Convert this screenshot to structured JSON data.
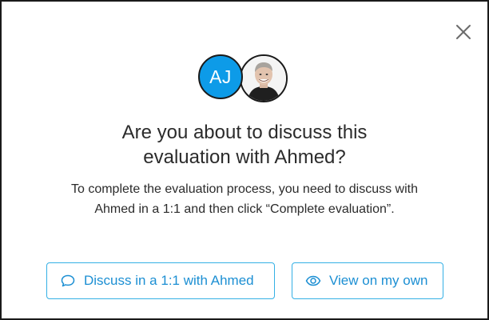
{
  "modal": {
    "close_icon": "close-icon",
    "avatars": {
      "initials": "AJ",
      "initials_color": "#0d9be8",
      "photo_icon": "user-photo"
    },
    "title_line1": "Are you about to discuss this",
    "title_line2": "evaluation with Ahmed?",
    "description_line1": "To complete the evaluation process, you need to discuss with",
    "description_line2": "Ahmed in a 1:1 and then click “Complete evaluation”.",
    "buttons": {
      "discuss": {
        "label": "Discuss in a 1:1 with Ahmed",
        "icon": "chat-bubble-icon"
      },
      "view": {
        "label": "View on my own",
        "icon": "eye-icon"
      }
    },
    "accent_color": "#1c8fd3"
  }
}
